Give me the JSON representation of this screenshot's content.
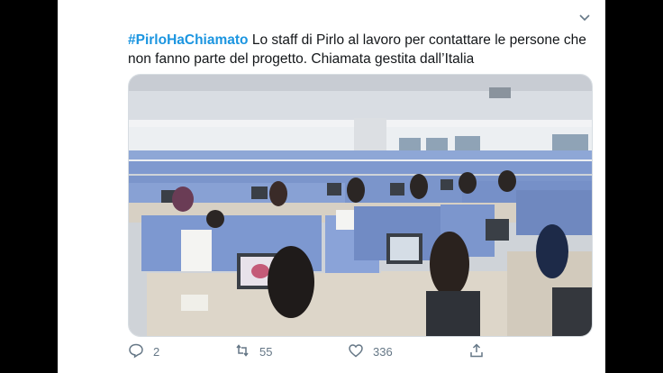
{
  "tweet": {
    "hashtag": "#PirloHaChiamato",
    "text": " Lo staff di Pirlo al lavoro per contattare le persone che non fanno parte del progetto. Chiamata gestita dall’Italia"
  },
  "media": {
    "description": ""
  },
  "actions": {
    "reply_count": "2",
    "retweet_count": "55",
    "like_count": "336"
  },
  "colors": {
    "hashtag": "#1b95e0",
    "text": "#14171a",
    "muted": "#657786"
  },
  "icons": [
    "chevron-down-icon",
    "reply-icon",
    "retweet-icon",
    "like-icon",
    "share-icon"
  ]
}
